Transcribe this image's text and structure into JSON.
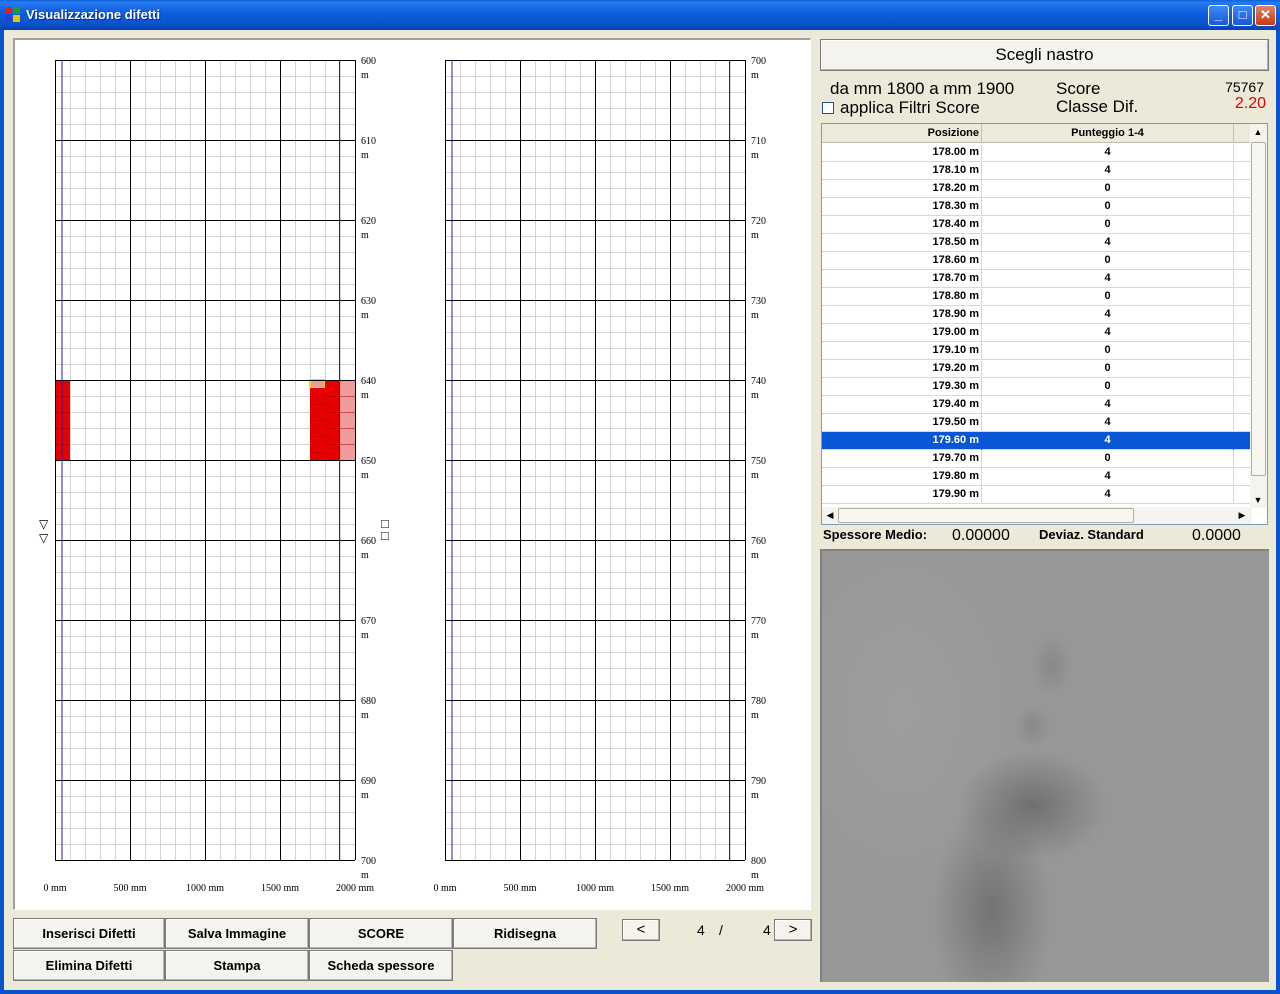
{
  "window": {
    "title": "Visualizzazione difetti",
    "controls": {
      "minimize": "_",
      "maximize": "□",
      "close": "✕"
    }
  },
  "chart_data": [
    {
      "type": "heatmap",
      "panel": "left",
      "x_ticks": [
        "0 mm",
        "500 mm",
        "1000 mm",
        "1500 mm",
        "2000 mm"
      ],
      "y_ticks": [
        "600",
        "610",
        "620",
        "630",
        "640",
        "650",
        "660",
        "670",
        "680",
        "690",
        "700"
      ],
      "y_unit": "m",
      "xlim": [
        0,
        2000
      ],
      "ylim": [
        600,
        700
      ],
      "defect_cells": [
        {
          "x_mm": [
            0,
            100
          ],
          "y_m": [
            640,
            650
          ],
          "color": "#e60000"
        },
        {
          "x_mm": [
            1700,
            1800
          ],
          "y_m": [
            640,
            641
          ],
          "color": "#f19a9a",
          "outline": "#f0e000"
        },
        {
          "x_mm": [
            1700,
            1800
          ],
          "y_m": [
            641,
            650
          ],
          "color": "#e60000"
        },
        {
          "x_mm": [
            1800,
            1900
          ],
          "y_m": [
            640,
            650
          ],
          "color": "#e60000"
        },
        {
          "x_mm": [
            1900,
            2000
          ],
          "y_m": [
            640,
            650
          ],
          "color": "#f19a9a"
        }
      ],
      "red_lines": [
        {
          "y_m": 610,
          "segments": [
            [
              0,
              100
            ],
            [
              1700,
              2000
            ]
          ],
          "faint": true
        },
        {
          "y_m": 620,
          "segments": [
            [
              0,
              100
            ],
            [
              1700,
              2000
            ]
          ]
        },
        {
          "y_m": 630,
          "segments": [
            [
              0,
              100
            ],
            [
              1700,
              2000
            ]
          ],
          "faint": true
        }
      ],
      "edge_lines_mm": [
        50,
        1900
      ],
      "markers": {
        "left_triangles": [
          "▽",
          "▽"
        ],
        "right_boxes": [
          "□",
          "□"
        ]
      }
    },
    {
      "type": "heatmap",
      "panel": "right",
      "x_ticks": [
        "0 mm",
        "500 mm",
        "1000 mm",
        "1500 mm",
        "2000 mm"
      ],
      "y_ticks": [
        "700",
        "710",
        "720",
        "730",
        "740",
        "750",
        "760",
        "770",
        "780",
        "790",
        "800"
      ],
      "y_unit": "m",
      "xlim": [
        0,
        2000
      ],
      "ylim": [
        700,
        800
      ],
      "defect_cells": [],
      "edge_lines_mm": [
        50,
        1900
      ]
    }
  ],
  "buttons": {
    "inserisci": "Inserisci Difetti",
    "salva": "Salva Immagine",
    "score": "SCORE",
    "ridisegna": "Ridisegna",
    "elimina": "Elimina Difetti",
    "stampa": "Stampa",
    "scheda": "Scheda spessore",
    "prev": "<",
    "next": ">",
    "scegli": "Scegli nastro"
  },
  "pager": {
    "current": "4",
    "sep": "/",
    "total": "4"
  },
  "info": {
    "range": "da mm 1800 a mm 1900",
    "score_label": "Score",
    "score_value": "75767",
    "filter_label": "applica Filtri Score",
    "classe_label": "Classe Dif.",
    "classe_value": "2.20",
    "classe_color": "#e00000"
  },
  "table": {
    "headers": [
      "Posizione",
      "Punteggio 1-4"
    ],
    "rows": [
      {
        "pos": "178.00 m",
        "score": "4"
      },
      {
        "pos": "178.10 m",
        "score": "4"
      },
      {
        "pos": "178.20 m",
        "score": "0"
      },
      {
        "pos": "178.30 m",
        "score": "0"
      },
      {
        "pos": "178.40 m",
        "score": "0"
      },
      {
        "pos": "178.50 m",
        "score": "4"
      },
      {
        "pos": "178.60 m",
        "score": "0"
      },
      {
        "pos": "178.70 m",
        "score": "4"
      },
      {
        "pos": "178.80 m",
        "score": "0"
      },
      {
        "pos": "178.90 m",
        "score": "4"
      },
      {
        "pos": "179.00 m",
        "score": "4"
      },
      {
        "pos": "179.10 m",
        "score": "0"
      },
      {
        "pos": "179.20 m",
        "score": "0"
      },
      {
        "pos": "179.30 m",
        "score": "0"
      },
      {
        "pos": "179.40 m",
        "score": "4"
      },
      {
        "pos": "179.50 m",
        "score": "4"
      },
      {
        "pos": "179.60 m",
        "score": "4",
        "selected": true
      },
      {
        "pos": "179.70 m",
        "score": "0"
      },
      {
        "pos": "179.80 m",
        "score": "4"
      },
      {
        "pos": "179.90 m",
        "score": "4"
      }
    ],
    "scroll_arrows": {
      "up": "▲",
      "down": "▼",
      "left": "◀",
      "right": "▶"
    }
  },
  "stats": {
    "spessore_label": "Spessore Medio:",
    "spessore_value": "0.00000",
    "deviaz_label": "Deviaz. Standard",
    "deviaz_value": "0.0000"
  },
  "colors": {
    "selection": "#0a57d6",
    "defect": "#e60000",
    "defect_light": "#f19a9a",
    "titlebar": "#0a52cc"
  }
}
